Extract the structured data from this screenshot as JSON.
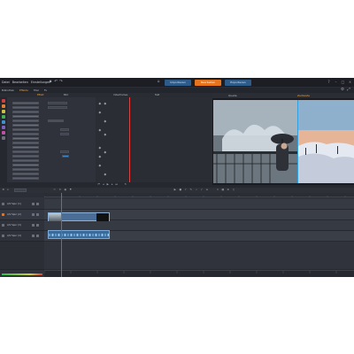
{
  "menu": {
    "items": [
      "Datei",
      "Bearbeiten",
      "Einstellungen"
    ]
  },
  "modes": {
    "importieren": "Importieren",
    "bearbeiten": "Bearbeiten",
    "exportieren": "Exportieren"
  },
  "library": {
    "tabs": [
      "Bibliothek",
      "Effekte",
      "Titel",
      "Fx"
    ]
  },
  "keyframes": {
    "columns": [
      "Effekt",
      "Bild",
      "Videoframes",
      "Takt"
    ]
  },
  "preview": {
    "tabs": [
      "Quelle",
      "Zeitleiste"
    ]
  },
  "timeline": {
    "tracks": [
      {
        "name": "A/V Spur (1)"
      },
      {
        "name": "A/V Spur (2)"
      },
      {
        "name": "A/V Spur (3)"
      },
      {
        "name": "A/V Spur (4)"
      }
    ]
  },
  "colors": {
    "accent": "#e8731d",
    "mode_blue": "#2e5c8a",
    "playhead": "#e04040",
    "selection": "#30a0e0"
  }
}
